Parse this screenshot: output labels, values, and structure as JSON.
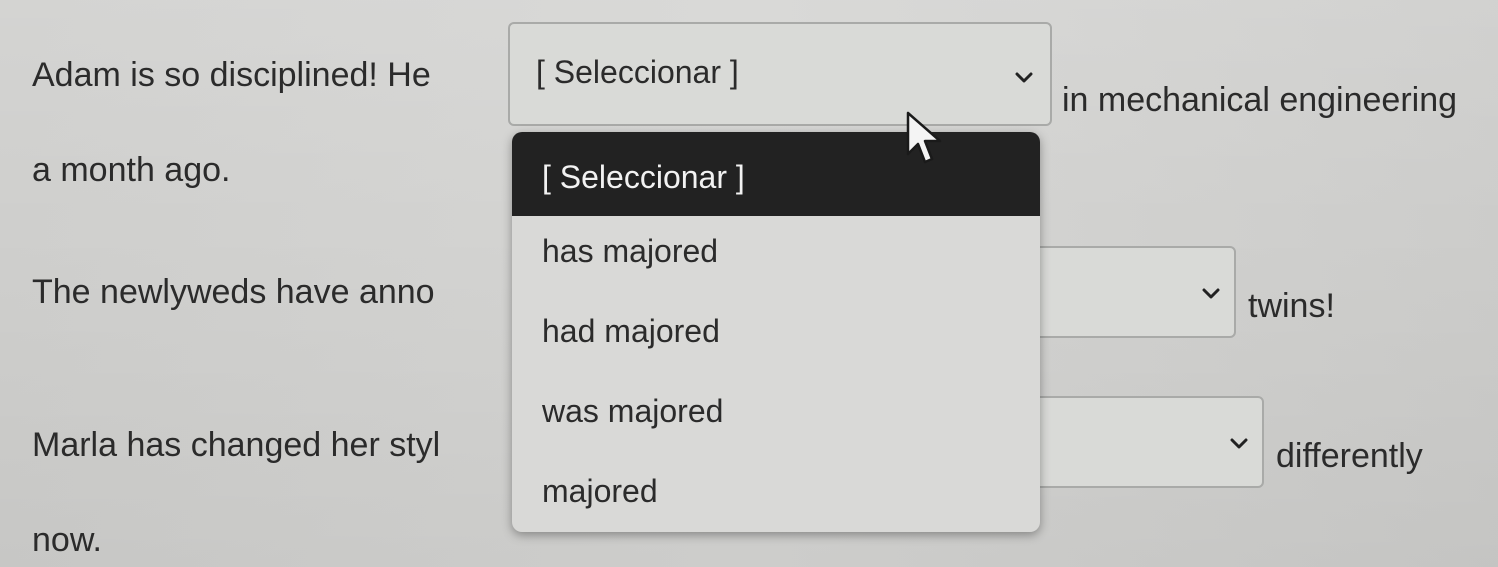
{
  "sentences": [
    {
      "before": "Adam is so disciplined! He",
      "after_line1": "in mechanical engineering",
      "after_line2": "a month ago.",
      "select_value": "[ Seleccionar ]"
    },
    {
      "before": "The newlyweds have anno",
      "after": "twins!"
    },
    {
      "before": "Marla has changed her styl",
      "after_line1": "differently",
      "after_line2": "now."
    }
  ],
  "dropdown": {
    "options": [
      "[ Seleccionar ]",
      "has majored",
      "had majored",
      "was majored",
      "majored"
    ],
    "highlighted_index": 0
  },
  "icons": {
    "chevron": "chevron-down-icon",
    "cursor": "mouse-pointer-icon"
  }
}
